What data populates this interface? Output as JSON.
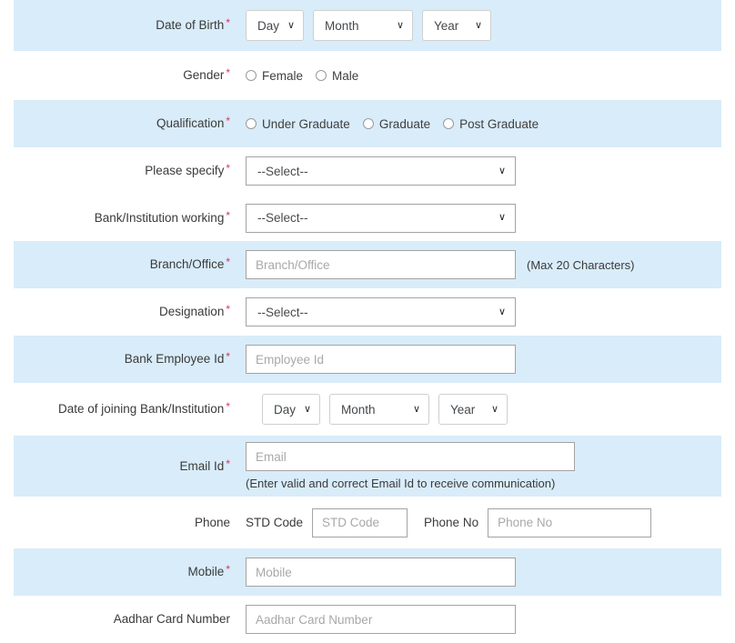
{
  "theme": {
    "stripe_color": "#d9ecf9",
    "page_background": "#ffffff",
    "required_marker_color": "#d9345a",
    "label_color": "#3a3a3a",
    "input_border_color": "#a3a3a3",
    "placeholder_color": "#a8a8a8"
  },
  "required_marker": "*",
  "chevron": "∨",
  "rows": {
    "date_of_birth": {
      "label": "Date of Birth",
      "day": "Day",
      "month": "Month",
      "year": "Year"
    },
    "gender": {
      "label": "Gender",
      "options": [
        "Female",
        "Male"
      ]
    },
    "qualification": {
      "label": "Qualification",
      "options": [
        "Under Graduate",
        "Graduate",
        "Post Graduate"
      ]
    },
    "please_specify": {
      "label": "Please specify",
      "value": "--Select--"
    },
    "bank_institution_working": {
      "label": "Bank/Institution working",
      "value": "--Select--"
    },
    "branch_office": {
      "label": "Branch/Office",
      "placeholder": "Branch/Office",
      "value": "",
      "hint": "(Max 20 Characters)"
    },
    "designation": {
      "label": "Designation",
      "value": "--Select--"
    },
    "bank_employee_id": {
      "label": "Bank Employee Id",
      "placeholder": "Employee Id",
      "value": ""
    },
    "date_of_joining": {
      "label": "Date of joining Bank/Institution",
      "day": "Day",
      "month": "Month",
      "year": "Year"
    },
    "email_id": {
      "label": "Email Id",
      "placeholder": "Email",
      "value": "",
      "note": "(Enter valid and correct Email Id to receive communication)"
    },
    "phone": {
      "label": "Phone",
      "std_code_label": "STD Code",
      "std_code_placeholder": "STD Code",
      "std_code_value": "",
      "phone_no_label": "Phone No",
      "phone_no_placeholder": "Phone No",
      "phone_no_value": ""
    },
    "mobile": {
      "label": "Mobile",
      "placeholder": "Mobile",
      "value": ""
    },
    "aadhar_card_number": {
      "label": "Aadhar Card Number",
      "placeholder": "Aadhar Card Number",
      "value": ""
    }
  }
}
